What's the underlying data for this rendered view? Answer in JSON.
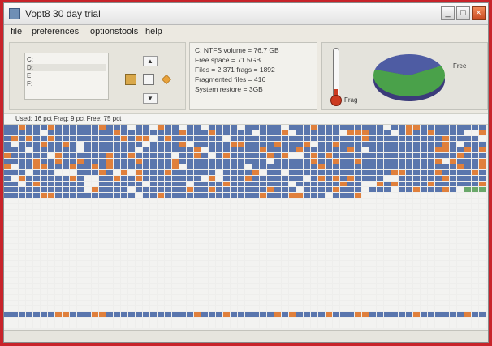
{
  "window": {
    "title": "Vopt8 30 day trial",
    "buttons": [
      "minimize",
      "maximize",
      "close"
    ]
  },
  "menu": {
    "items": [
      "file",
      "preferences",
      "options",
      "tools",
      "help"
    ]
  },
  "drive_list": {
    "rows": [
      "C:",
      "D:",
      "E:",
      "F:"
    ]
  },
  "nav_buttons": {
    "up": "▲",
    "down": "▼"
  },
  "stats": {
    "lines": [
      "C: NTFS volume = 76.7 GB",
      "Free space = 71.5GB",
      "Files = 2,371 frags = 1892",
      "Fragmented files = 416",
      "System restore = 3GB"
    ]
  },
  "usage": {
    "free_label": "Free",
    "used_label": "Frag",
    "free_fraction": 0.62,
    "colors": {
      "free": "#4aa14a",
      "used": "#4e5ca3"
    }
  },
  "thermometer": {
    "level": 0.12,
    "label": "Frag"
  },
  "legend_strip": {
    "text": "Used: 16 pct  Frag: 9 pct  Free: 75 pct"
  },
  "colors": {
    "block_used": "#5a76ad",
    "block_frag": "#e0803c",
    "block_free": "#f3f3f1",
    "block_system": "#6aa86a"
  }
}
